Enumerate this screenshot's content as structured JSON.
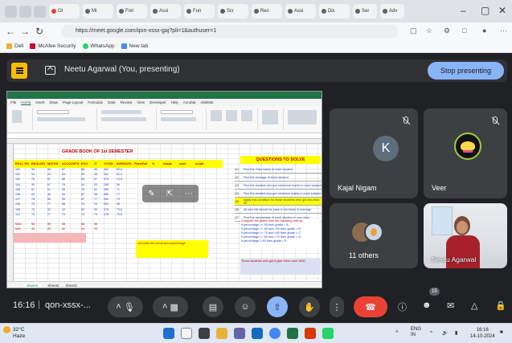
{
  "browser": {
    "tab_labels": [
      "Ol",
      "Mi",
      "Fori",
      "Assi",
      "Fun",
      "Scr",
      "Res",
      "Assi",
      "Dis",
      "Ser",
      "Adv",
      "Kal",
      "Dav",
      "Ch",
      "Mi",
      "Mi"
    ],
    "url": "https://meet.google.com/qon-xssx-gaj?pli=1&authuser=1",
    "bookmarks": [
      "Dell",
      "McAfee Security",
      "WhatsApp",
      "New tab"
    ]
  },
  "meet": {
    "presenting_text": "Neetu Agarwal (You, presenting)",
    "stop_button": "Stop presenting",
    "participants": [
      {
        "name": "Kajal Nigam",
        "initial": "K",
        "muted": true
      },
      {
        "name": "Veer",
        "muted": true
      },
      {
        "name": "11 others"
      },
      {
        "name": "Neetu Agarwal"
      }
    ],
    "time": "16:16",
    "meeting_code": "qon-xssx-...",
    "participant_count": "15"
  },
  "spreadsheet": {
    "ribbon_tabs": [
      "File",
      "Home",
      "Insert",
      "Draw",
      "Page Layout",
      "Formulas",
      "Data",
      "Review",
      "View",
      "Developer",
      "Help",
      "Acrobat",
      "Ablebits"
    ],
    "grade_book_title": "GRADE BOOK OF 1st SEMESTER",
    "questions_title": "QUESTIONS TO SOLVE",
    "headers": [
      "ROLL NO.",
      "ENGLISH",
      "MATHS",
      "ACCOUNTS",
      "ECO",
      "IT",
      "TOTAL",
      "AVERAGE",
      "Pass/Fail",
      "%",
      "Grade",
      "cash",
      "credit"
    ],
    "rows": [
      [
        "101",
        "98",
        "99",
        "87",
        "88",
        "90",
        "462",
        "92.4"
      ],
      [
        "102",
        "54",
        "23",
        "84",
        "55",
        "45",
        "261",
        "52.2"
      ],
      [
        "103",
        "76",
        "87",
        "88",
        "56",
        "67",
        "374",
        "74.8"
      ],
      [
        "104",
        "40",
        "67",
        "76",
        "44",
        "53",
        "280",
        "56"
      ],
      [
        "105",
        "67",
        "51",
        "98",
        "78",
        "61",
        "355",
        "71"
      ],
      [
        "106",
        "90",
        "46",
        "64",
        "87",
        "98",
        "385",
        "77"
      ],
      [
        "107",
        "76",
        "55",
        "55",
        "87",
        "77",
        "350",
        "70"
      ],
      [
        "108",
        "76",
        "77",
        "88",
        "76",
        "23",
        "340",
        "68"
      ],
      [
        "109",
        "75",
        "93",
        "32",
        "83",
        "95",
        "378",
        "75.6"
      ],
      [
        "110",
        "75",
        "77",
        "74",
        "73",
        "79",
        "378",
        "75.6"
      ],
      [
        "MAX",
        "98",
        "99",
        "98",
        "88",
        "98",
        "",
        ""
      ],
      [
        "MIN",
        "40",
        "23",
        "32",
        "44",
        "23",
        "",
        ""
      ]
    ],
    "questions": [
      "Find the Total marks of each student",
      "Find the Average of each student",
      "Find the student who got maximum marks in each subject",
      "Find the student who got minimum marks in each subject",
      "Apply this condition for those students who got less than 35",
      "All who fail should be pass in the basis of average",
      "Find the percentage of each student in your data"
    ],
    "grade_lines": [
      "Compute the grade from the following criteria:",
      "If percentage >= 90 then grade = A",
      "If percentage >= 80 and <90 then grade = B",
      "If percentage >= 70 and <80 then grade = C",
      "If percentage >= 60 and <70 then grade = D",
      "If percentage < 60 then grade = E"
    ],
    "note_yellow": "calculate the credit who percentage",
    "note_blue": "Those students who got A give them cash 1000",
    "sheets": [
      "Sheet1",
      "Sheet2",
      "Sheet3"
    ]
  },
  "taskbar": {
    "temp": "32°C",
    "weather": "Haze",
    "lang": "ENG",
    "region": "IN",
    "time": "16:16",
    "date": "14-10-2024"
  }
}
